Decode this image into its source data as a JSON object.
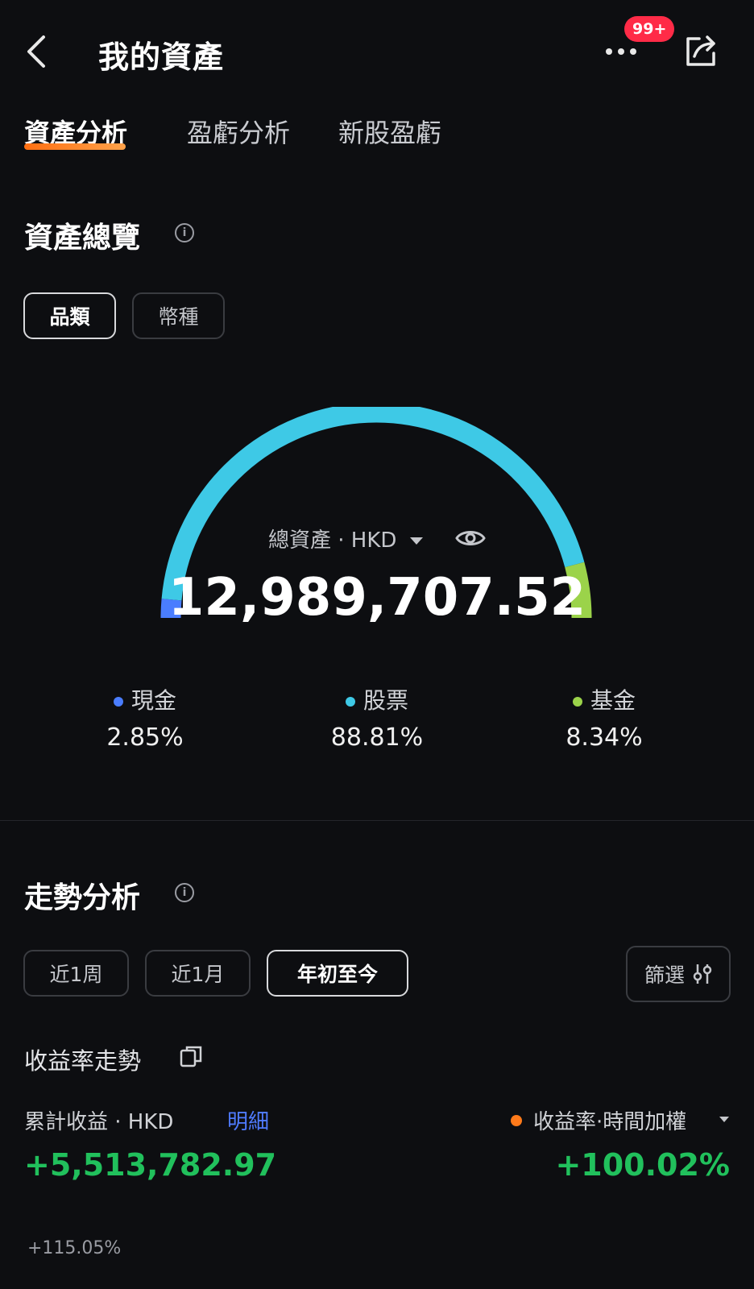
{
  "header": {
    "title": "我的資產",
    "badge": "99+"
  },
  "tabs": [
    {
      "label": "資產分析"
    },
    {
      "label": "盈虧分析"
    },
    {
      "label": "新股盈虧"
    }
  ],
  "overview": {
    "title": "資產總覽",
    "chips": [
      "品類",
      "幣種"
    ],
    "center_label": "總資產 · HKD",
    "total": "12,989,707.52",
    "legend": [
      {
        "name": "現金",
        "value": "2.85%",
        "color": "#4a7dff"
      },
      {
        "name": "股票",
        "value": "88.81%",
        "color": "#3ec9e6"
      },
      {
        "name": "基金",
        "value": "8.34%",
        "color": "#9bd34a"
      }
    ]
  },
  "trend": {
    "title": "走勢分析",
    "periods": [
      "近1周",
      "近1月",
      "年初至今"
    ],
    "filter_label": "篩選",
    "yield_title": "收益率走勢",
    "cumulative_label": "累計收益 · HKD",
    "detail_link": "明細",
    "cumulative_value": "+5,513,782.97",
    "rate_label": "收益率·時間加權",
    "rate_value": "+100.02%",
    "axis_top": "+115.05%"
  },
  "colors": {
    "accent": "#ff7a1a",
    "positive": "#21c05c",
    "link": "#4f7bff",
    "badge": "#ff2b47"
  }
}
